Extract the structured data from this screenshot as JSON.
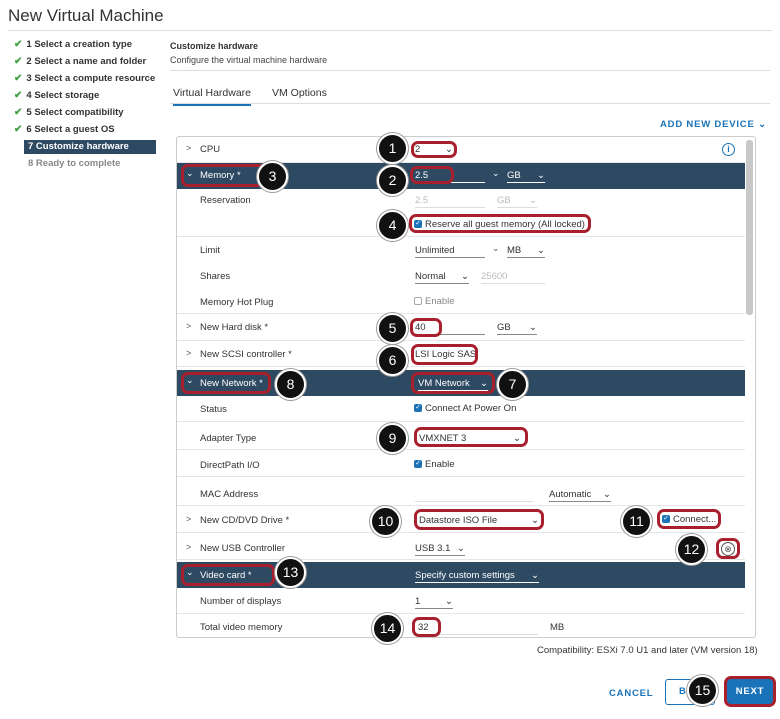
{
  "window_title": "New Virtual Machine",
  "steps": [
    {
      "label": "1 Select a creation type",
      "state": "done"
    },
    {
      "label": "2 Select a name and folder",
      "state": "done"
    },
    {
      "label": "3 Select a compute resource",
      "state": "done"
    },
    {
      "label": "4 Select storage",
      "state": "done"
    },
    {
      "label": "5 Select compatibility",
      "state": "done"
    },
    {
      "label": "6 Select a guest OS",
      "state": "done"
    },
    {
      "label": "7 Customize hardware",
      "state": "active"
    },
    {
      "label": "8 Ready to complete",
      "state": "pending"
    }
  ],
  "check_glyph": "✔",
  "header": {
    "title": "Customize hardware",
    "subtitle": "Configure the virtual machine hardware"
  },
  "tabs": [
    "Virtual Hardware",
    "VM Options"
  ],
  "add_device": "ADD NEW DEVICE",
  "info_glyph": "i",
  "hardware": {
    "cpu": {
      "label": "CPU",
      "value": "2"
    },
    "memory": {
      "label": "Memory *",
      "value": "2.5",
      "unit": "GB",
      "reservation_label": "Reservation",
      "reservation_value": "2.5",
      "reservation_unit": "GB",
      "reserve_all": "Reserve all guest memory (All locked)",
      "limit_label": "Limit",
      "limit_value": "Unlimited",
      "limit_unit": "MB",
      "shares_label": "Shares",
      "shares_level": "Normal",
      "shares_value": "25600",
      "hotplug_label": "Memory Hot Plug",
      "hotplug_value": "Enable"
    },
    "hard_disk": {
      "label": "New Hard disk *",
      "value": "40",
      "unit": "GB"
    },
    "scsi": {
      "label": "New SCSI controller *",
      "value": "LSI Logic SAS"
    },
    "network": {
      "label": "New Network *",
      "value": "VM Network",
      "status_label": "Status",
      "status_value": "Connect At Power On",
      "adapter_label": "Adapter Type",
      "adapter_value": "VMXNET 3",
      "directpath_label": "DirectPath I/O",
      "directpath_value": "Enable",
      "mac_label": "MAC Address",
      "mac_mode": "Automatic"
    },
    "cdrom": {
      "label": "New CD/DVD Drive *",
      "value": "Datastore ISO File",
      "connect": "Connect..."
    },
    "usb": {
      "label": "New USB Controller",
      "value": "USB 3.1"
    },
    "video": {
      "label": "Video card *",
      "value": "Specify custom settings",
      "displays_label": "Number of displays",
      "displays_value": "1",
      "memory_label": "Total video memory",
      "memory_value": "32",
      "memory_unit": "MB"
    }
  },
  "compatibility": "Compatibility: ESXi 7.0 U1 and later (VM version 18)",
  "buttons": {
    "cancel": "CANCEL",
    "back": "B",
    "next": "NEXT"
  },
  "callouts": [
    "1",
    "2",
    "3",
    "4",
    "5",
    "6",
    "7",
    "8",
    "9",
    "10",
    "11",
    "12",
    "13",
    "14",
    "15"
  ],
  "glyphs": {
    "chev_right": ">",
    "chev_down": "⌄",
    "dropdown": "⌄",
    "remove": "⊗",
    "check": "✓"
  },
  "colors": {
    "accent": "#1a73b8",
    "header_row": "#2e4a62",
    "highlight": "#a8202d",
    "done_check": "#43a047"
  }
}
